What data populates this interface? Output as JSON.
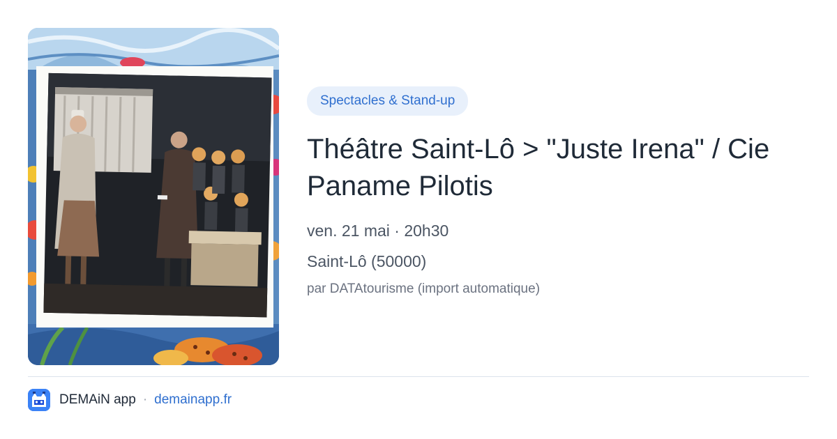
{
  "event": {
    "category": "Spectacles & Stand-up",
    "title": "Théâtre Saint-Lô > \"Juste Irena\" / Cie Paname Pilotis",
    "date_time": "ven. 21 mai · 20h30",
    "location": "Saint-Lô (50000)",
    "source": "par DATAtourisme (import automatique)"
  },
  "footer": {
    "app_name": "DEMAiN app",
    "separator": "·",
    "url": "demainapp.fr"
  },
  "colors": {
    "accent": "#2f6fcf",
    "pill_bg": "#e8f0fb",
    "logo_bg": "#3b82f6"
  },
  "icons": {
    "app_logo": "demain-cat-logo-icon"
  }
}
